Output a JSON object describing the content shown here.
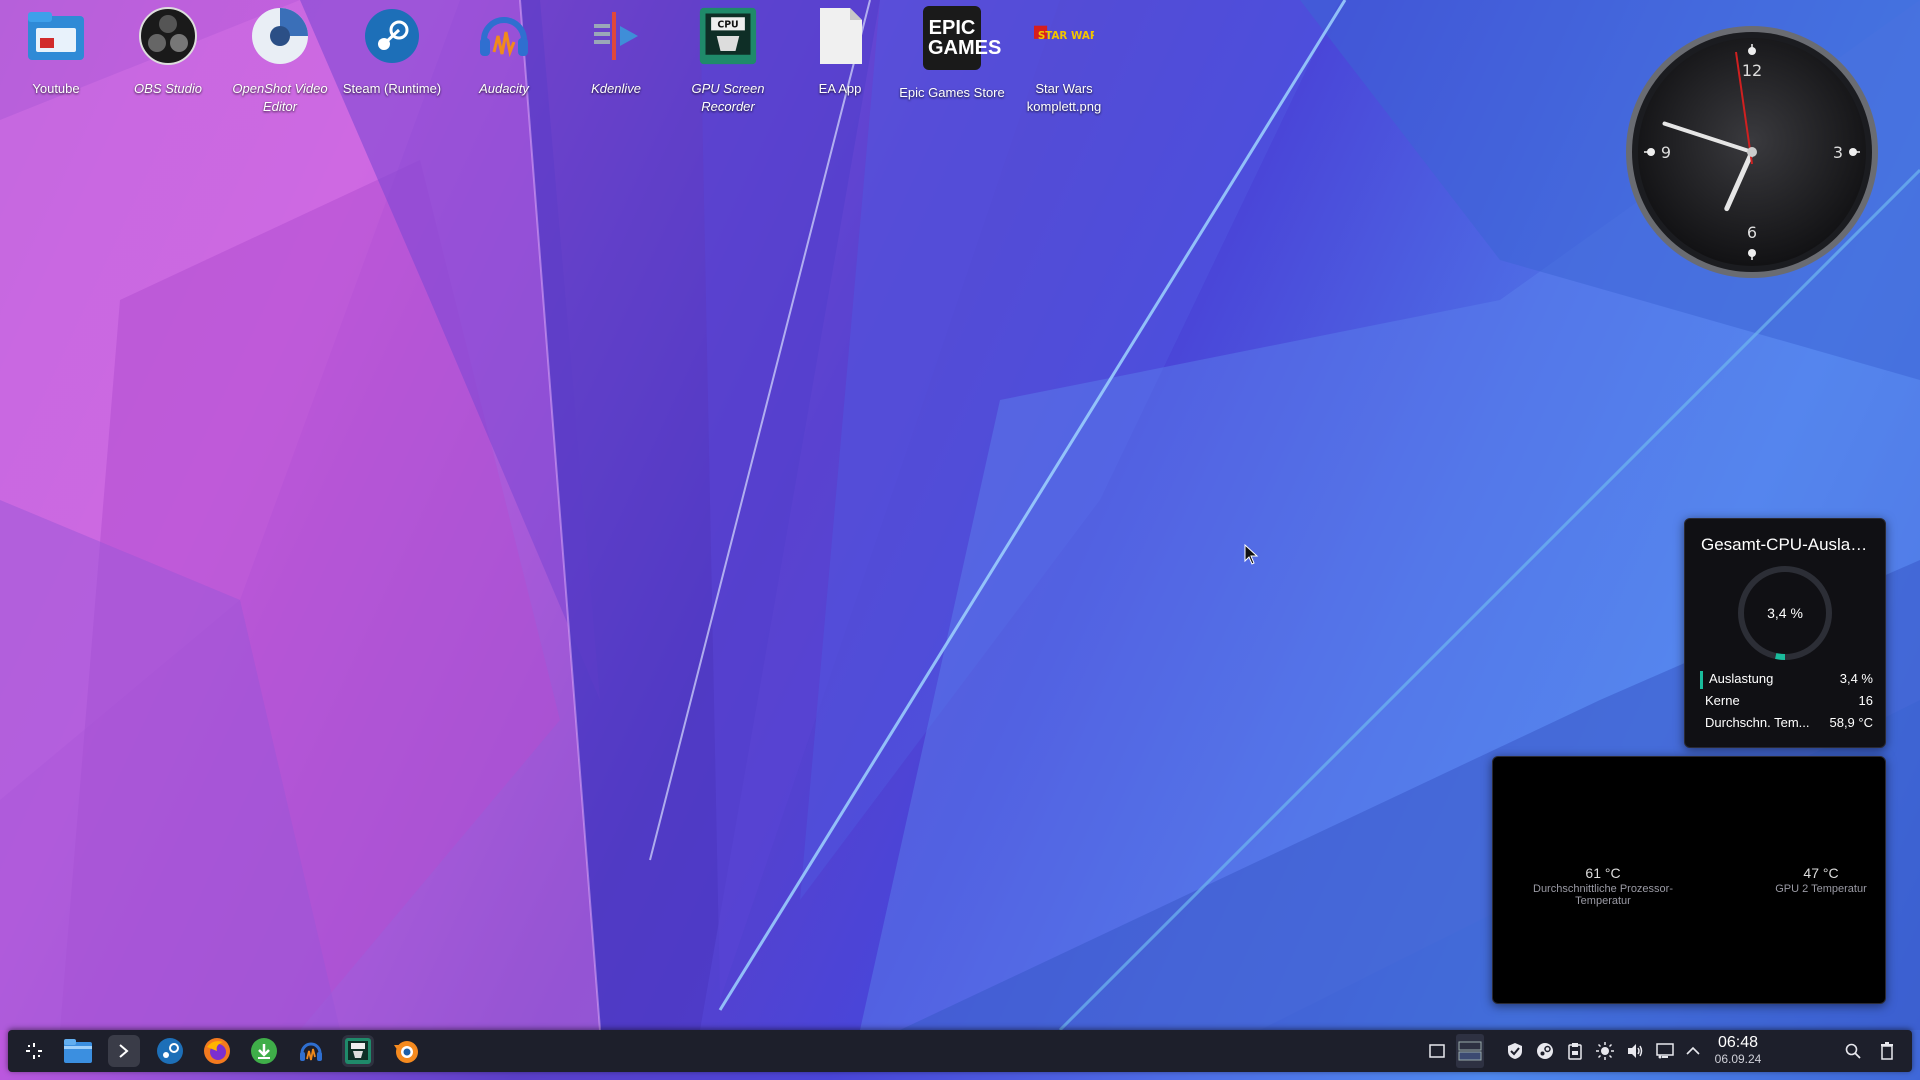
{
  "desktop": {
    "icons": [
      {
        "name": "Youtube",
        "italic": false,
        "icon": "folder-video-icon"
      },
      {
        "name": "OBS Studio",
        "italic": true,
        "icon": "obs-studio-icon"
      },
      {
        "name": "OpenShot Video Editor",
        "italic": true,
        "icon": "openshot-icon"
      },
      {
        "name": "Steam (Runtime)",
        "italic": false,
        "icon": "steam-icon"
      },
      {
        "name": "Audacity",
        "italic": true,
        "icon": "audacity-icon"
      },
      {
        "name": "Kdenlive",
        "italic": true,
        "icon": "kdenlive-icon"
      },
      {
        "name": "GPU Screen Recorder",
        "italic": true,
        "icon": "gpu-screen-recorder-icon"
      },
      {
        "name": "EA App",
        "italic": false,
        "icon": "blank-file-icon"
      },
      {
        "name": "Epic Games Store",
        "italic": false,
        "icon": "epic-games-icon"
      },
      {
        "name": "Star Wars komplett.png",
        "italic": false,
        "icon": "lego-star-wars-image-icon"
      }
    ],
    "epic_logo_text": "EPIC GAMES",
    "gpu_icon_text": "CPU",
    "lego_logo_text": "STAR WARS"
  },
  "clock": {
    "numbers": [
      "12",
      "3",
      "6",
      "9"
    ],
    "time": "06:48"
  },
  "cpu_widget": {
    "title": "Gesamt-CPU-Auslast...",
    "gauge_value": "3,4 %",
    "gauge_fraction": 0.034,
    "rows": [
      {
        "key": "Auslastung",
        "value": "3,4 %"
      },
      {
        "key": "Kerne",
        "value": "16"
      },
      {
        "key": "Durchschn. Tem...",
        "value": "58,9 °C"
      }
    ],
    "accent": "#1abc9c"
  },
  "temp_widget": {
    "sensors": [
      {
        "value": "61 °C",
        "label": "Durchschnittliche Prozessor-Temperatur"
      },
      {
        "value": "47 °C",
        "label": "GPU 2 Temperatur"
      }
    ]
  },
  "taskbar": {
    "launchers": [
      "app-launcher-icon",
      "file-manager-icon",
      "terminal-icon",
      "steam-icon",
      "firefox-icon",
      "download-manager-icon",
      "audacity-icon",
      "gpu-screen-recorder-icon",
      "blender-icon"
    ],
    "tray": [
      "show-desktop-icon",
      "pager-icon",
      "vpn-shield-icon",
      "steam-tray-icon",
      "clipboard-icon",
      "brightness-icon",
      "volume-icon",
      "network-icon",
      "expand-tray-icon"
    ],
    "time": "06:48",
    "date": "06.09.24"
  }
}
